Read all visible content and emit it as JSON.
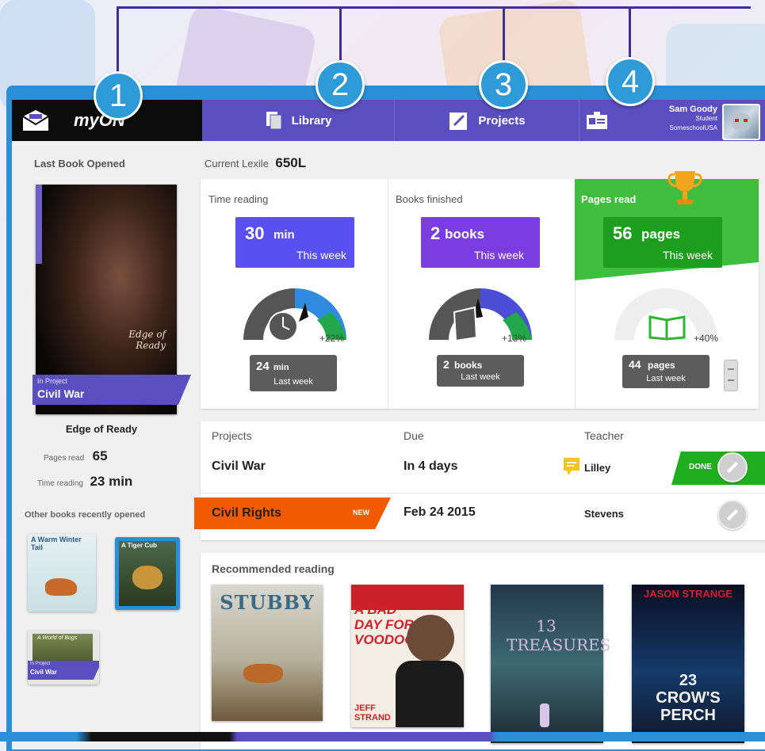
{
  "colors": {
    "nav_purple": "#5a4fc0",
    "callout_blue": "#2f9ad8",
    "blue_stat": "#5a4ff0",
    "purple_stat": "#7a3de0",
    "green_stat": "#2fb52f",
    "orange_new": "#f25a00"
  },
  "callouts": [
    "1",
    "2",
    "3",
    "4"
  ],
  "nav": {
    "logo": "myON",
    "library_label": "Library",
    "projects_label": "Projects",
    "user": {
      "name": "Sam Goody",
      "role": "Student",
      "school": "SomeschoolUSA"
    }
  },
  "sidebar": {
    "last_book_heading": "Last Book Opened",
    "cover_title": "Edge of Ready",
    "in_project_small": "In Project",
    "in_project_name": "Civil War",
    "book_title": "Edge of Ready",
    "pages_read_label": "Pages read",
    "pages_read_value": "65",
    "time_reading_label": "Time reading",
    "time_reading_value": "23 min",
    "other_books_heading": "Other books recently opened",
    "other_books": [
      {
        "title": "A Warm Winter Tail"
      },
      {
        "title": "A Tiger Cub"
      },
      {
        "title": "A World of Bugs",
        "in_project_small": "In Project",
        "in_project_name": "Civil War"
      }
    ]
  },
  "lexile": {
    "label": "Current Lexile",
    "value": "650L"
  },
  "stats": [
    {
      "heading": "Time reading",
      "value": "30",
      "unit": "min",
      "period": "This week",
      "change": "+22%",
      "last_value": "24",
      "last_unit": "min",
      "last_period": "Last week",
      "icon": "clock-icon"
    },
    {
      "heading": "Books finished",
      "value": "2",
      "unit": "books",
      "period": "This week",
      "change": "+13%",
      "last_value": "2",
      "last_unit": "books",
      "last_period": "Last week",
      "icon": "book-icon"
    },
    {
      "heading": "Pages read",
      "value": "56",
      "unit": "pages",
      "period": "This week",
      "change": "+40%",
      "last_value": "44",
      "last_unit": "pages",
      "last_period": "Last week",
      "icon": "open-book-icon"
    }
  ],
  "projects": {
    "headers": {
      "projects": "Projects",
      "due": "Due",
      "teacher": "Teacher"
    },
    "rows": [
      {
        "name": "Civil War",
        "due": "In 4 days",
        "teacher": "Lilley",
        "status": "DONE"
      },
      {
        "name": "Civil Rights",
        "badge": "NEW",
        "due": "Feb 24 2015",
        "teacher": "Stevens"
      }
    ]
  },
  "recommended": {
    "heading": "Recommended reading",
    "books": [
      {
        "title": "STUBBY"
      },
      {
        "title": "A BAD DAY FOR VOODOO",
        "author": "JEFF STRAND"
      },
      {
        "title": "13 TREASURES"
      },
      {
        "title": "23 CROW'S PERCH",
        "author": "JASON STRANGE"
      }
    ]
  }
}
